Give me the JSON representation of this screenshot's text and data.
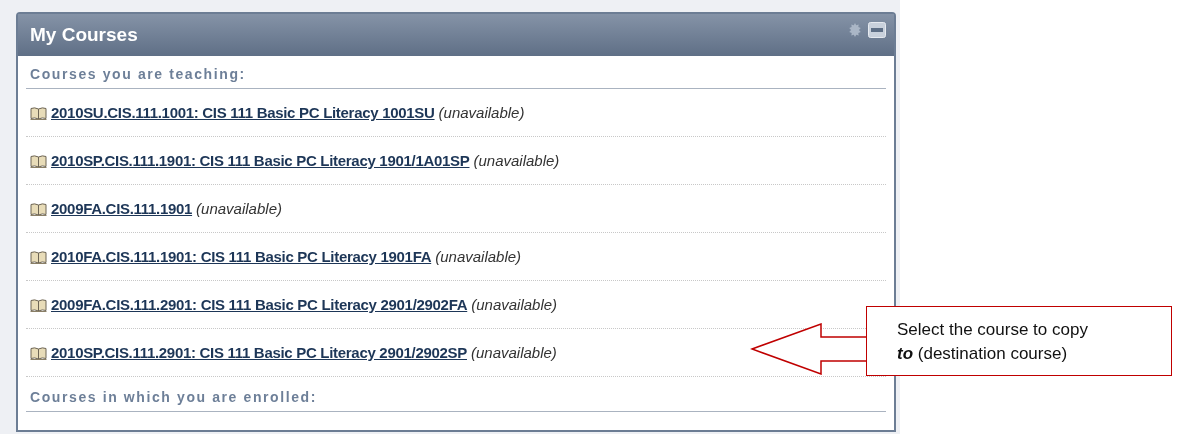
{
  "panel": {
    "title": "My Courses"
  },
  "sections": [
    {
      "heading": "Courses you are teaching:",
      "courses": [
        {
          "link": "2010SU.CIS.111.1001: CIS 111 Basic PC Literacy 1001SU",
          "status": "(unavailable)"
        },
        {
          "link": "2010SP.CIS.111.1901: CIS 111 Basic PC Literacy 1901/1A01SP",
          "status": "(unavailable)"
        },
        {
          "link": "2009FA.CIS.111.1901",
          "status": "(unavailable)"
        },
        {
          "link": "2010FA.CIS.111.1901: CIS 111 Basic PC Literacy 1901FA",
          "status": "(unavailable)"
        },
        {
          "link": "2009FA.CIS.111.2901: CIS 111 Basic PC Literacy 2901/2902FA",
          "status": "(unavailable)"
        },
        {
          "link": "2010SP.CIS.111.2901: CIS 111 Basic PC Literacy 2901/2902SP",
          "status": "(unavailable)"
        }
      ]
    },
    {
      "heading": "Courses in which you are enrolled:"
    }
  ],
  "callout": {
    "text": "Select the course to copy **to** (destination course)"
  }
}
